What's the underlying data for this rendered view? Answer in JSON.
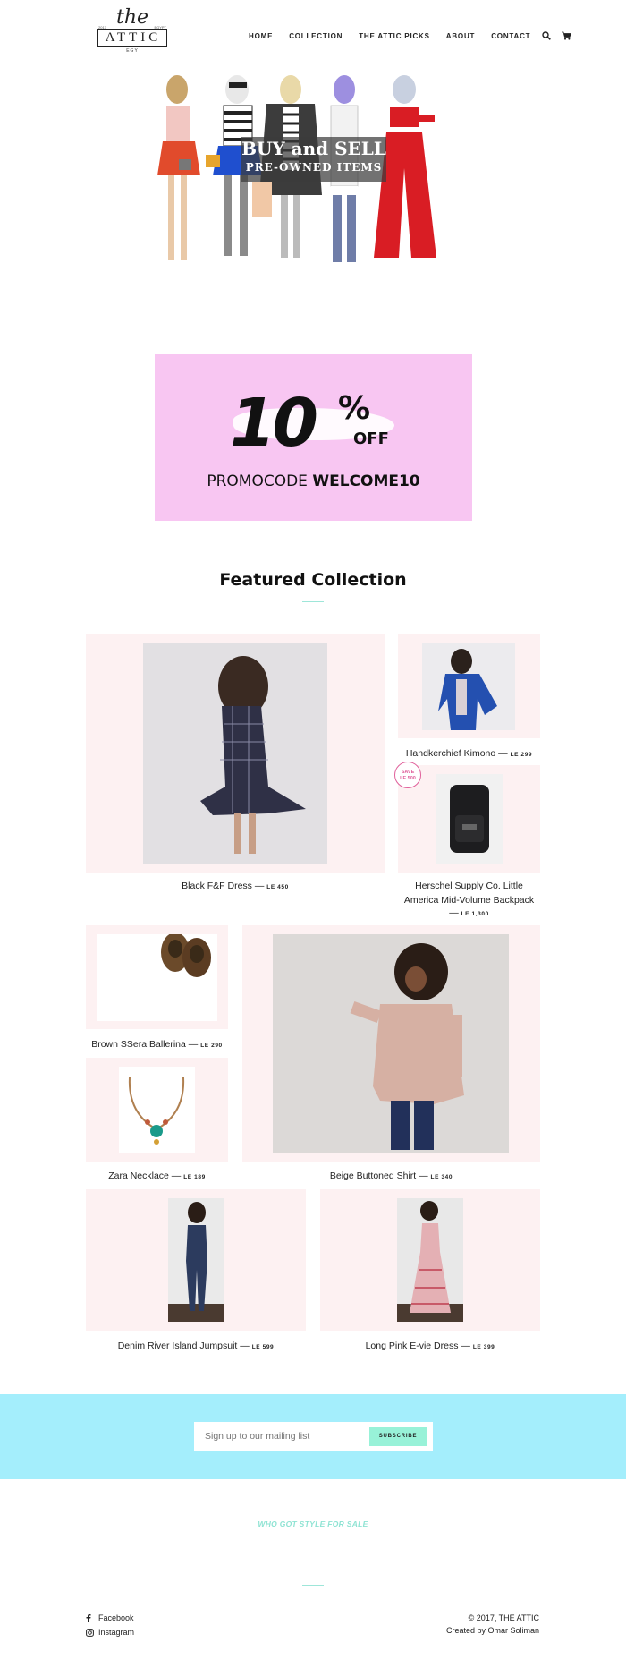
{
  "header": {
    "logo": {
      "the": "the",
      "word": "ATTIC",
      "est_left": "2017",
      "est_right": "EGYPT",
      "sub": "EGY"
    },
    "nav": [
      "HOME",
      "COLLECTION",
      "THE ATTIC PICKS",
      "ABOUT",
      "CONTACT"
    ],
    "icons": [
      "search-icon",
      "cart-icon"
    ]
  },
  "hero": {
    "line1": "BUY and SELL",
    "line2": "PRE-OWNED ITEMS"
  },
  "promo": {
    "big": "10",
    "pct": "%",
    "off": "OFF",
    "code_prefix": "PROMOCODE ",
    "code": "WELCOME10",
    "bg": "#f8c6f2"
  },
  "featured": {
    "title": "Featured Collection",
    "products": [
      {
        "name": "Black F&F Dress",
        "price": "LE 450"
      },
      {
        "name": "Handkerchief Kimono",
        "price": "LE 299"
      },
      {
        "name": "Herschel Supply Co. Little",
        "name2": "America Mid-Volume Backpack",
        "price": "LE 1,300",
        "badge1": "SAVE",
        "badge2": "LE 500"
      },
      {
        "name": "Brown SSera Ballerina",
        "price": "LE 290"
      },
      {
        "name": "Beige Buttoned Shirt",
        "price": "LE 340"
      },
      {
        "name": "Zara Necklace",
        "price": "LE 189"
      },
      {
        "name": "Denim River Island Jumpsuit",
        "price": "LE 599"
      },
      {
        "name": "Long Pink E-vie Dress",
        "price": "LE 399"
      }
    ]
  },
  "newsletter": {
    "placeholder": "Sign up to our mailing list",
    "button": "SUBSCRIBE",
    "bg": "#a4eefc",
    "button_bg": "#98f2d8"
  },
  "tagline": "WHO GOT STYLE FOR SALE",
  "footer": {
    "facebook": "Facebook",
    "instagram": "Instagram",
    "copyright": "© 2017, THE ATTIC",
    "credit": "Created by Omar Soliman"
  }
}
